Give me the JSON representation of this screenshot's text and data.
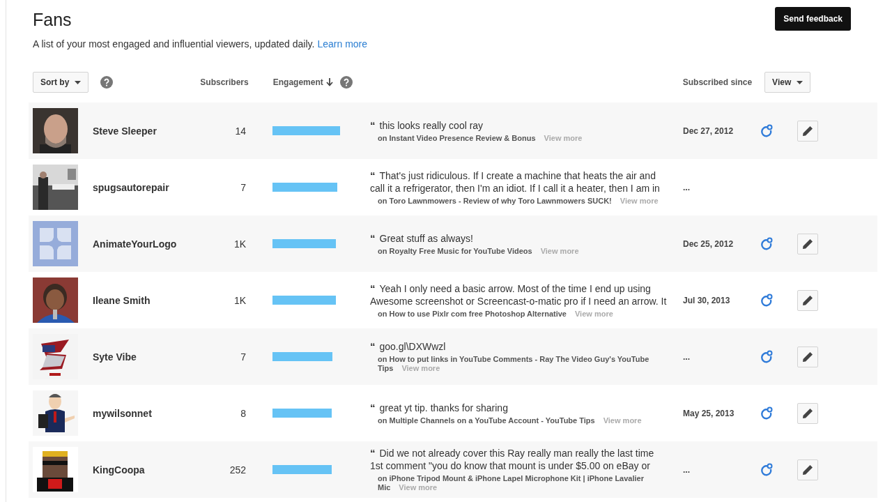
{
  "title": "Fans",
  "subtitle": "A list of your most engaged and influential viewers, updated daily.",
  "learn_more": "Learn more",
  "send_feedback": "Send feedback",
  "sort_by": "Sort by",
  "columns": {
    "subscribers": "Subscribers",
    "engagement": "Engagement",
    "subscribed_since": "Subscribed since"
  },
  "view_button": "View",
  "fans": [
    {
      "name": "Steve Sleeper",
      "subscribers": "14",
      "comment": {
        "quote": "“",
        "text": "this looks really cool ray",
        "video": "on Instant Video Presence Review & Bonus",
        "view_more": "View more"
      },
      "subscribed": "Dec 27, 2012",
      "actions": true
    },
    {
      "name": "spugsautorepair",
      "subscribers": "7",
      "comment": {
        "quote": "“",
        "text": "That's just ridiculous. If I create a machine that heats the air and call it a refrigerator, then I'm an idiot. If I call it a heater, then I am in",
        "video": "on Toro Lawnmowers - Review of why Toro Lawnmowers SUCK!",
        "view_more": "View more"
      },
      "subscribed": "...",
      "actions": false
    },
    {
      "name": "AnimateYourLogo",
      "subscribers": "1K",
      "comment": {
        "quote": "“",
        "text": "Great stuff as always!",
        "video": "on Royalty Free Music for YouTube Videos",
        "view_more": "View more"
      },
      "subscribed": "Dec 25, 2012",
      "actions": true
    },
    {
      "name": "Ileane Smith",
      "subscribers": "1K",
      "comment": {
        "quote": "“",
        "text": "Yeah I only need a basic arrow. Most of the time I end up using Awesome screenshot or Screencast-o-matic pro if I need an arrow. It",
        "video": "on How to use Pixlr com free Photoshop Alternative",
        "view_more": "View more"
      },
      "subscribed": "Jul 30, 2013",
      "actions": true
    },
    {
      "name": "Syte Vibe",
      "subscribers": "7",
      "comment": {
        "quote": "“",
        "text": "goo.gl\\DXWwzl",
        "video": "on How to put links in YouTube Comments - Ray The Video Guy's YouTube Tips",
        "view_more": "View more"
      },
      "subscribed": "...",
      "actions": true
    },
    {
      "name": "mywilsonnet",
      "subscribers": "8",
      "comment": {
        "quote": "“",
        "text": "great yt tip. thanks for sharing",
        "video": "on Multiple Channels on a YouTube Account - YouTube Tips",
        "view_more": "View more"
      },
      "subscribed": "May 25, 2013",
      "actions": true
    },
    {
      "name": "KingCoopa",
      "subscribers": "252",
      "comment": {
        "quote": "“",
        "text": "Did we not already cover this Ray really man really the last time 1st comment \"you do know that mount is under $5.00 on eBay or",
        "video": "on iPhone Tripod Mount & iPhone Lapel Microphone Kit | iPhone Lavalier Mic",
        "view_more": "View more"
      },
      "subscribed": "...",
      "actions": true
    }
  ]
}
